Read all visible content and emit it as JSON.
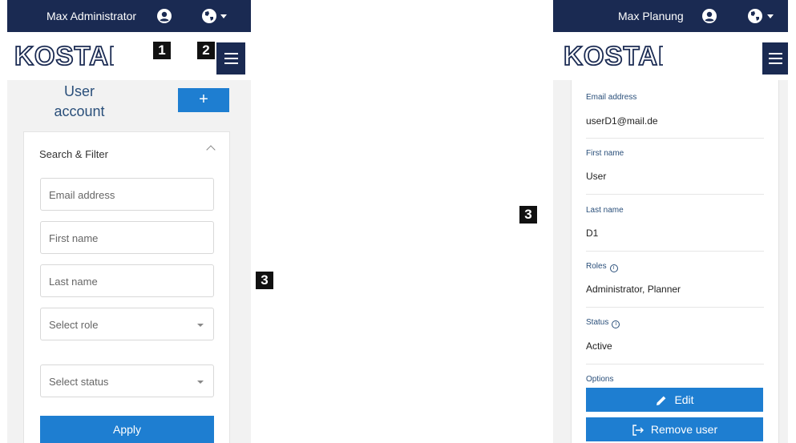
{
  "left": {
    "topbar": {
      "user_name": "Max Administrator"
    },
    "logo_text": "KOSTAL",
    "page_title_line1": "User",
    "page_title_line2": "account",
    "add_button_label": "+",
    "filter": {
      "title": "Search & Filter",
      "email_placeholder": "Email address",
      "first_name_placeholder": "First name",
      "last_name_placeholder": "Last name",
      "role_placeholder": "Select role",
      "status_placeholder": "Select status",
      "apply_label": "Apply"
    }
  },
  "right": {
    "topbar": {
      "user_name": "Max Planung"
    },
    "logo_text": "KOSTAL",
    "details": {
      "email_label": "Email address",
      "email_value": "userD1@mail.de",
      "first_name_label": "First name",
      "first_name_value": "User",
      "last_name_label": "Last name",
      "last_name_value": "D1",
      "roles_label": "Roles",
      "roles_value": "Administrator, Planner",
      "status_label": "Status",
      "status_value": "Active",
      "options_label": "Options",
      "edit_label": "Edit",
      "remove_label": "Remove user"
    }
  },
  "callouts": {
    "c1": "1",
    "c2": "2",
    "c3_left": "3",
    "c3_right": "3"
  },
  "colors": {
    "navy": "#1a2a52",
    "primary_blue": "#1e7ed1",
    "label_blue": "#2a4f7a"
  },
  "icons": [
    "account-circle-icon",
    "globe-icon",
    "menu-icon",
    "plus-icon",
    "chevron-up-icon",
    "pencil-icon",
    "logout-icon",
    "info-icon"
  ]
}
